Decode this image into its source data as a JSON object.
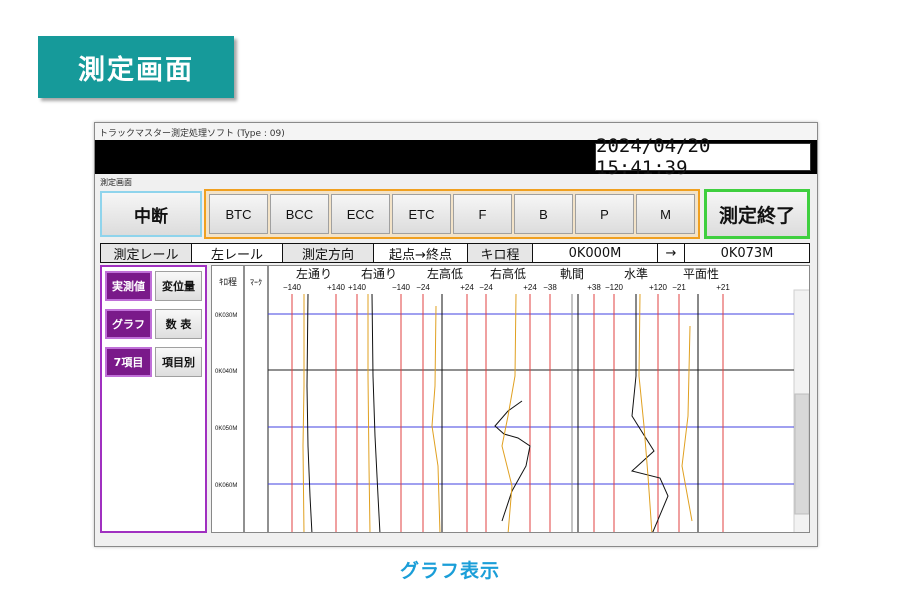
{
  "heading": "測定画面",
  "caption": "グラフ表示",
  "window": {
    "title": "トラックマスター測定処理ソフト (Type : 09)",
    "datetime": "2024/04/20 15:41:39",
    "screen_label": "測定画面",
    "interrupt_label": "中断",
    "end_label": "測定終了",
    "options": [
      "BTC",
      "BCC",
      "ECC",
      "ETC",
      "F",
      "B",
      "P",
      "M"
    ]
  },
  "info": {
    "rail_label": "測定レール",
    "rail_value": "左レール",
    "dir_label": "測定方向",
    "dir_value": "起点→終点",
    "km_label": "キロ程",
    "km_start": "0K000M",
    "arrow": "→",
    "km_end": "0K073M"
  },
  "panel": {
    "measured": "実測値",
    "displacement": "変位量",
    "graph": "グラフ",
    "table": "数 表",
    "seven": "7項目",
    "by_item": "項目別"
  },
  "graph": {
    "km_header": "ｷﾛ程",
    "mark_header": "ﾏｰｸ",
    "columns": [
      {
        "title": "左通り",
        "min": "−140",
        "max": "+140"
      },
      {
        "title": "右通り",
        "min": "+140",
        "max": "−140"
      },
      {
        "title": "左高低",
        "min": "−24",
        "max": "+24"
      },
      {
        "title": "右高低",
        "min": "−24",
        "max": "+24"
      },
      {
        "title": "軌間",
        "min": "−38",
        "max": "+38"
      },
      {
        "title": "水準",
        "min": "−120",
        "max": "+120"
      },
      {
        "title": "平面性",
        "min": "−21",
        "max": "+21"
      }
    ],
    "km_ticks": [
      "0K030M",
      "0K040M",
      "0K050M",
      "0K060M"
    ]
  },
  "colors": {
    "badge": "#169a9a",
    "caption": "#1a9ed8",
    "interrupt_border": "#8fd4ec",
    "option_border": "#f0a020",
    "end_border": "#3fcf3f",
    "panel_border": "#a030c0",
    "selected_button": "#7a1a8a"
  }
}
